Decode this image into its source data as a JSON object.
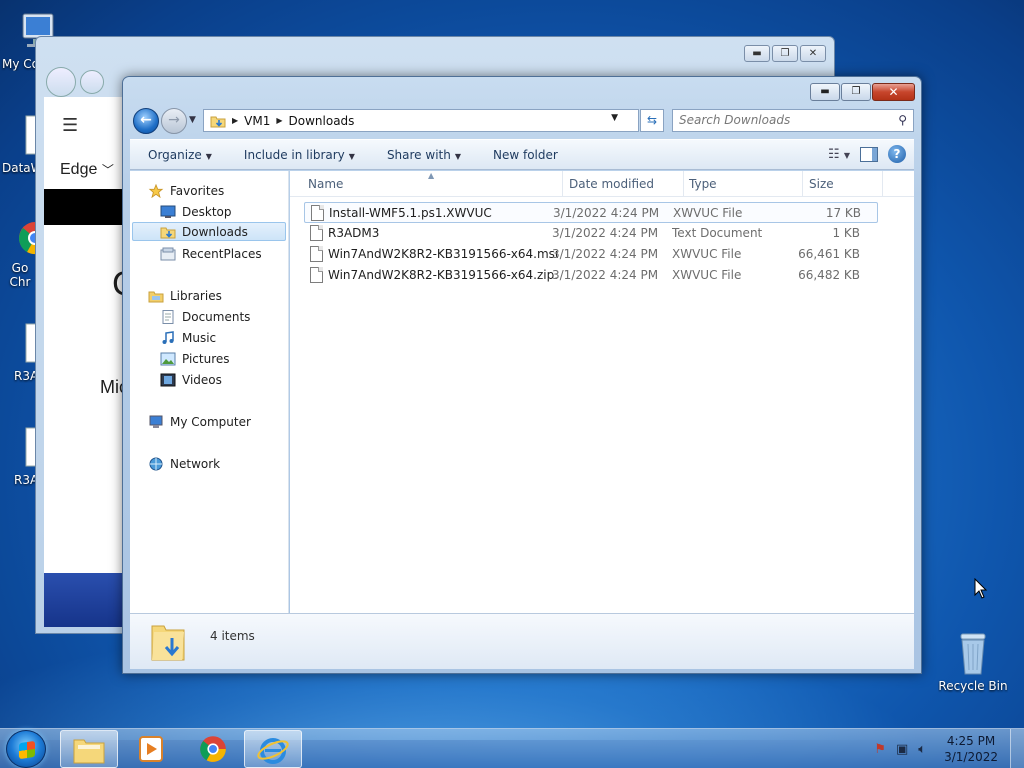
{
  "desktop": {
    "icons": [
      {
        "label": "My Co"
      },
      {
        "label": "DataW"
      },
      {
        "label": "Go Chr"
      },
      {
        "label": "R3A"
      },
      {
        "label": "R3A"
      },
      {
        "label": "Recycle Bin"
      }
    ]
  },
  "background_window": {
    "edge_label": "Edge",
    "big_letter": "C",
    "mic_text": "Mic"
  },
  "explorer": {
    "address": {
      "segments": [
        "VM1",
        "Downloads"
      ]
    },
    "search": {
      "placeholder": "Search Downloads"
    },
    "toolbar": {
      "organize": "Organize",
      "include_in_library": "Include in library",
      "share_with": "Share with",
      "new_folder": "New folder"
    },
    "nav": {
      "favorites": "Favorites",
      "desktop": "Desktop",
      "downloads": "Downloads",
      "recent_places": "RecentPlaces",
      "libraries": "Libraries",
      "documents": "Documents",
      "music": "Music",
      "pictures": "Pictures",
      "videos": "Videos",
      "my_computer": "My Computer",
      "network": "Network"
    },
    "columns": {
      "name": "Name",
      "date_modified": "Date modified",
      "type": "Type",
      "size": "Size"
    },
    "files": [
      {
        "name": "Install-WMF5.1.ps1.XWVUC",
        "date": "3/1/2022 4:24 PM",
        "type": "XWVUC File",
        "size": "17 KB"
      },
      {
        "name": "R3ADM3",
        "date": "3/1/2022 4:24 PM",
        "type": "Text Document",
        "size": "1 KB"
      },
      {
        "name": "Win7AndW2K8R2-KB3191566-x64.msu.X...",
        "date": "3/1/2022 4:24 PM",
        "type": "XWVUC File",
        "size": "66,461 KB"
      },
      {
        "name": "Win7AndW2K8R2-KB3191566-x64.zip.XW...",
        "date": "3/1/2022 4:24 PM",
        "type": "XWVUC File",
        "size": "66,482 KB"
      }
    ],
    "details": {
      "item_count": "4 items"
    }
  },
  "taskbar": {
    "clock": {
      "time": "4:25 PM",
      "date": "3/1/2022"
    }
  },
  "colors": {
    "accent": "#1d6fc7",
    "close": "#c7452c",
    "selection": "#cde4f8"
  }
}
